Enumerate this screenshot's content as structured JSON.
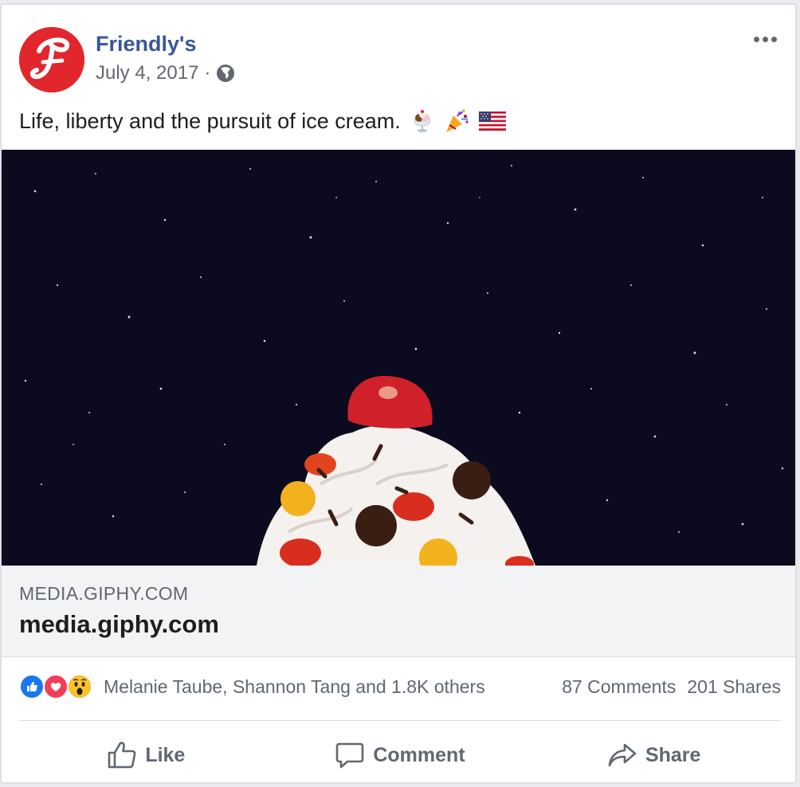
{
  "post": {
    "page_name": "Friendly's",
    "date": "July 4, 2017",
    "privacy_icon": "globe-icon",
    "text": "Life, liberty and the pursuit of ice cream.",
    "text_emojis": [
      "ice-cream-sundae-icon",
      "party-popper-icon",
      "us-flag-icon"
    ],
    "more_icon": "more-horizontal-icon"
  },
  "media": {
    "description_icon": "giphy-gif-icon"
  },
  "link": {
    "domain": "MEDIA.GIPHY.COM",
    "title": "media.giphy.com"
  },
  "reactions": {
    "icons": [
      "like-reaction-icon",
      "love-reaction-icon",
      "wow-reaction-icon"
    ],
    "names": "Melanie Taube, Shannon Tang and 1.8K others",
    "comments": "87 Comments",
    "shares": "201 Shares"
  },
  "actions": {
    "like": "Like",
    "comment": "Comment",
    "share": "Share"
  },
  "colors": {
    "brand_red": "#e1262d",
    "link_blue": "#385898",
    "like_blue": "#1877f2",
    "love_red": "#f33e58",
    "wow_yellow": "#f7b125"
  }
}
